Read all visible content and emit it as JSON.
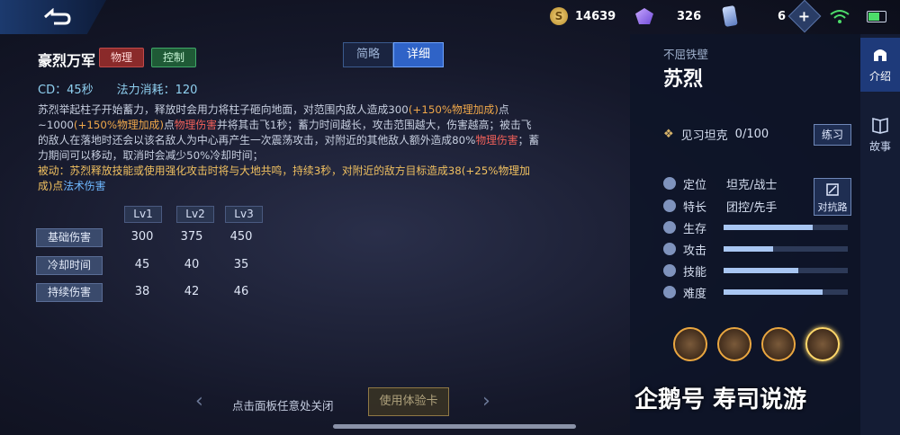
{
  "topbar": {
    "coins": "14639",
    "gems": "326",
    "cards": "6",
    "plus": "+"
  },
  "skill": {
    "name": "豪烈万军",
    "tags": [
      "物理",
      "控制"
    ],
    "cd": "CD：45秒",
    "cost": "法力消耗：120",
    "view_tabs": [
      "简略",
      "详细"
    ],
    "desc": [
      {
        "t": "苏烈举起柱子开始蓄力，释放时会用力将柱子砸向地面，对范围内敌人造成300",
        "c": ""
      },
      {
        "t": "(+150%物理加成)",
        "c": "o"
      },
      {
        "t": "点~1000",
        "c": ""
      },
      {
        "t": "(+150%物理加成)",
        "c": "o"
      },
      {
        "t": "点",
        "c": ""
      },
      {
        "t": "物理伤害",
        "c": "r"
      },
      {
        "t": "并将其击飞1秒；蓄力时间越长，攻击范围越大，伤害越高；被击飞的敌人在落地时还会以该名敌人为中心再产生一次震荡攻击，对附近的其他敌人额外造成80%",
        "c": ""
      },
      {
        "t": "物理伤害",
        "c": "r"
      },
      {
        "t": "；蓄力期间可以移动，取消时会减少50%冷却时间；",
        "c": ""
      }
    ],
    "passive": [
      {
        "t": "被动：苏烈释放技能或使用强化攻击时将与大地共鸣，持续3秒，对附近的敌方目标造成38(+25%物理加成)点",
        "c": "p"
      },
      {
        "t": "法术伤害",
        "c": "b"
      }
    ],
    "levels": [
      "Lv1",
      "Lv2",
      "Lv3"
    ],
    "rows": [
      {
        "label": "基础伤害",
        "values": [
          "300",
          "375",
          "450"
        ]
      },
      {
        "label": "冷却时间",
        "values": [
          "45",
          "40",
          "35"
        ]
      },
      {
        "label": "持续伤害",
        "values": [
          "38",
          "42",
          "46"
        ]
      }
    ]
  },
  "bottom": {
    "hint": "点击面板任意处关闭",
    "trial_button": "使用体验卡",
    "prev": "‹",
    "next": "›"
  },
  "hero": {
    "subtitle": "不屈铁壁",
    "name": "苏烈",
    "rank": "见习坦克",
    "rank_progress": "0/100",
    "practice": "练习",
    "position_label": "定位",
    "position": "坦克/战士",
    "specialty_label": "特长",
    "specialty": "团控/先手",
    "counter": "对抗路",
    "ratings": [
      {
        "label": "生存",
        "value": 0.72
      },
      {
        "label": "攻击",
        "value": 0.4
      },
      {
        "label": "技能",
        "value": 0.6
      },
      {
        "label": "难度",
        "value": 0.8
      }
    ]
  },
  "side_tabs": [
    "介绍",
    "故事"
  ],
  "watermark": "企鹅号 寿司说游"
}
